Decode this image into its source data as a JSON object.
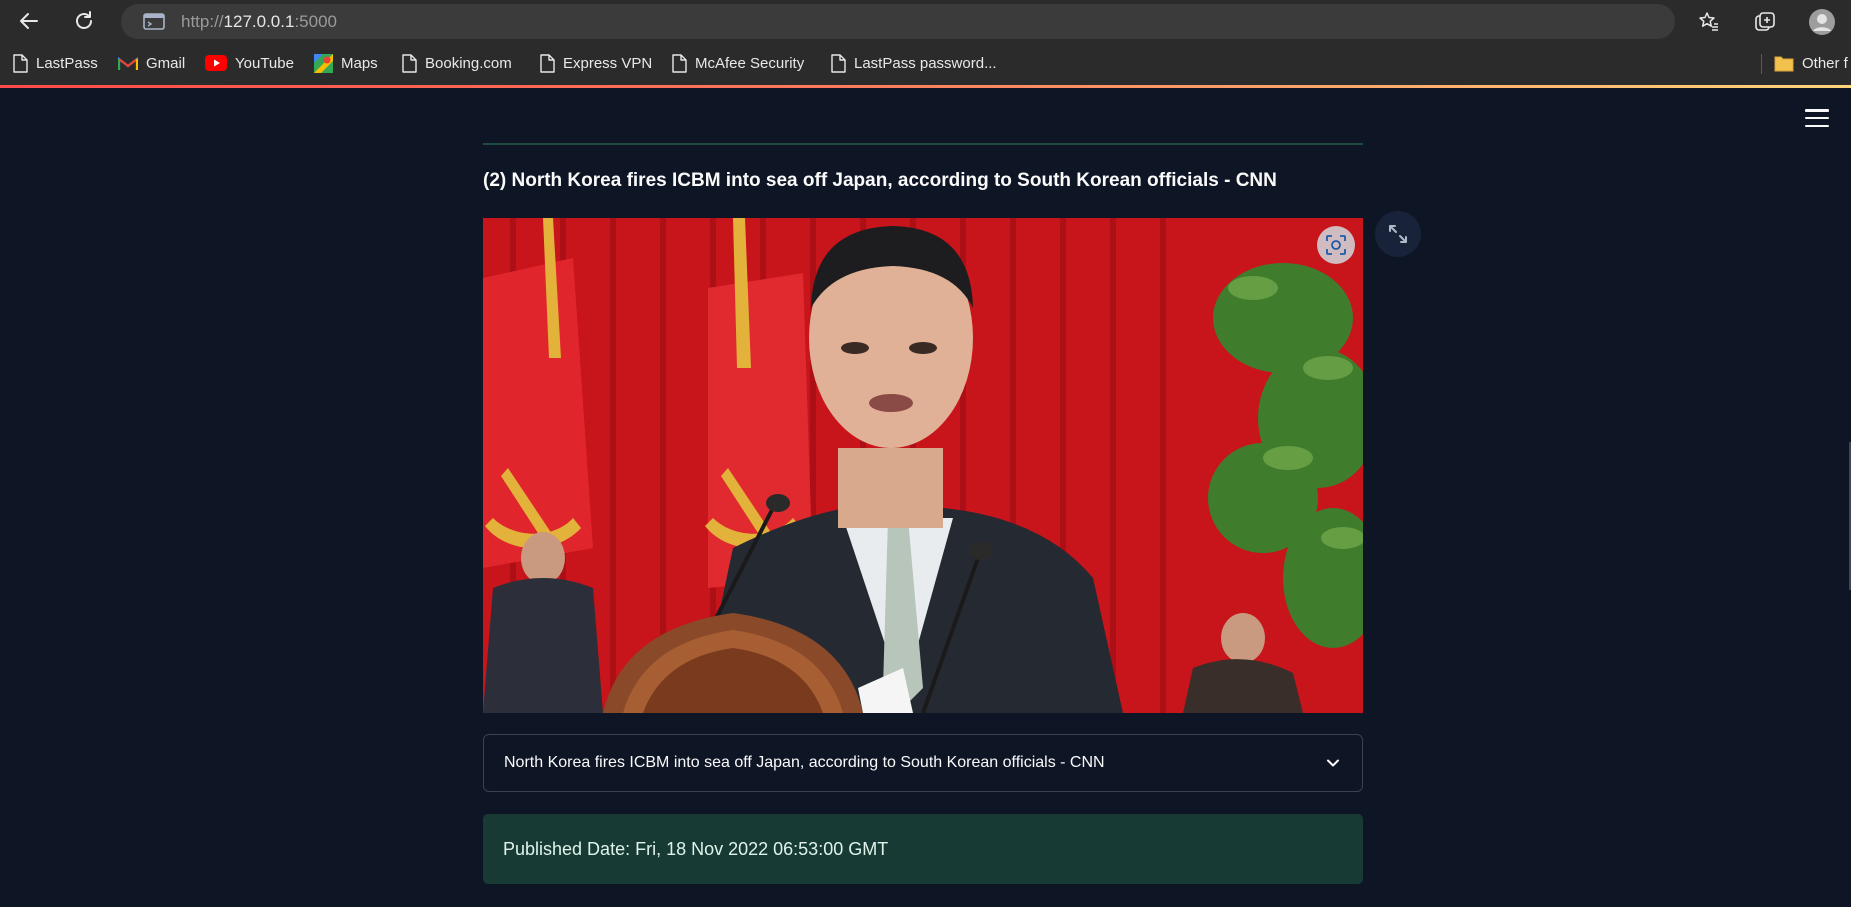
{
  "browser": {
    "url_scheme": "http://",
    "url_host": "127.0.0.1",
    "url_port": ":5000",
    "bookmarks": [
      {
        "label": "LastPass",
        "icon": "page-icon"
      },
      {
        "label": "Gmail",
        "icon": "gmail-icon"
      },
      {
        "label": "YouTube",
        "icon": "youtube-icon"
      },
      {
        "label": "Maps",
        "icon": "maps-icon"
      },
      {
        "label": "Booking.com",
        "icon": "page-icon"
      },
      {
        "label": "Express VPN",
        "icon": "page-icon"
      },
      {
        "label": "McAfee Security",
        "icon": "page-icon"
      },
      {
        "label": "LastPass password...",
        "icon": "page-icon"
      },
      {
        "label": "Other f",
        "icon": "folder-icon"
      }
    ],
    "loading_gradient": [
      "#ff4b4b",
      "#ffd57a"
    ]
  },
  "article": {
    "title": "(2) North Korea fires ICBM into sea off Japan, according to South Korean officials - CNN",
    "image_description_icon": "photo-of-speaker-at-podium",
    "expander_label": "North Korea fires ICBM into sea off Japan, according to South Korean officials - CNN",
    "expander_state": "collapsed",
    "published": "Published Date: Fri, 18 Nov 2022 06:53:00 GMT"
  },
  "colors": {
    "background": "#0e1525",
    "accent_divider": "#1f4a42",
    "success_box": "#173a35"
  }
}
